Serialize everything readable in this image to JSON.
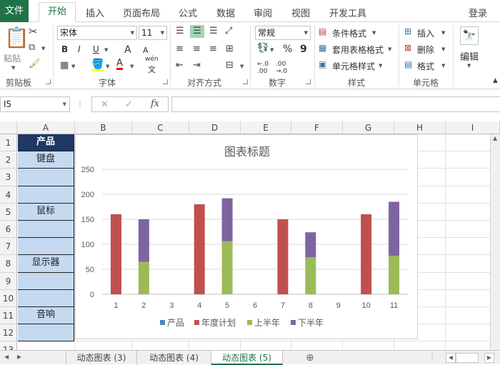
{
  "ribbon_tabs": {
    "file": "文件",
    "home": "开始",
    "insert": "插入",
    "page_layout": "页面布局",
    "formulas": "公式",
    "data": "数据",
    "review": "审阅",
    "view": "视图",
    "developer": "开发工具",
    "login": "登录"
  },
  "clipboard": {
    "paste": "粘贴",
    "group": "剪贴板"
  },
  "font": {
    "name": "宋体",
    "size": "11",
    "bold": "B",
    "italic": "I",
    "underline": "U",
    "grow": "A",
    "shrink": "A",
    "group": "字体",
    "phonetic": "wén"
  },
  "alignment": {
    "group": "对齐方式"
  },
  "number": {
    "format": "常规",
    "percent": "%",
    "comma": "9",
    "group": "数字"
  },
  "styles": {
    "conditional": "条件格式",
    "table": "套用表格格式",
    "cell": "单元格样式",
    "group": "样式"
  },
  "cells": {
    "insert": "插入",
    "delete": "删除",
    "format": "格式",
    "group": "单元格"
  },
  "editing": {
    "label": "编辑"
  },
  "formula_bar": {
    "name_box": "I5",
    "fx": "fx",
    "cancel": "✕",
    "enter": "✓",
    "value": ""
  },
  "columns": [
    "A",
    "B",
    "C",
    "D",
    "E",
    "F",
    "G",
    "H",
    "I"
  ],
  "rows": [
    "1",
    "2",
    "3",
    "4",
    "5",
    "6",
    "7",
    "8",
    "9",
    "10",
    "11",
    "12",
    "13"
  ],
  "column_a": {
    "header": "产品",
    "items": [
      "键盘",
      "鼠标",
      "显示器",
      "音响"
    ]
  },
  "chart_data": {
    "type": "bar",
    "title": "图表标题",
    "categories": [
      "1",
      "2",
      "3",
      "4",
      "5",
      "6",
      "7",
      "8",
      "9",
      "10",
      "11"
    ],
    "ylim": [
      0,
      250
    ],
    "yticks": [
      0,
      50,
      100,
      150,
      200,
      250
    ],
    "grid": true,
    "legend": "bottom",
    "stacked": true,
    "series": [
      {
        "name": "产品",
        "color": "#4f81bd",
        "values": [
          0,
          0,
          0,
          0,
          0,
          0,
          0,
          0,
          0,
          0,
          0
        ]
      },
      {
        "name": "年度计划",
        "color": "#c0504d",
        "values": [
          160,
          0,
          0,
          180,
          0,
          0,
          150,
          0,
          0,
          160,
          0
        ]
      },
      {
        "name": "上半年",
        "color": "#9bbb59",
        "values": [
          0,
          65,
          0,
          0,
          106,
          0,
          0,
          74,
          0,
          0,
          77
        ]
      },
      {
        "name": "下半年",
        "color": "#8064a2",
        "values": [
          0,
          85,
          0,
          0,
          86,
          0,
          0,
          50,
          0,
          0,
          108
        ]
      }
    ]
  },
  "sheet_tabs": [
    "动态图表 (3)",
    "动态图表 (4)",
    "动态图表 (5)"
  ],
  "add_sheet": "⊕"
}
